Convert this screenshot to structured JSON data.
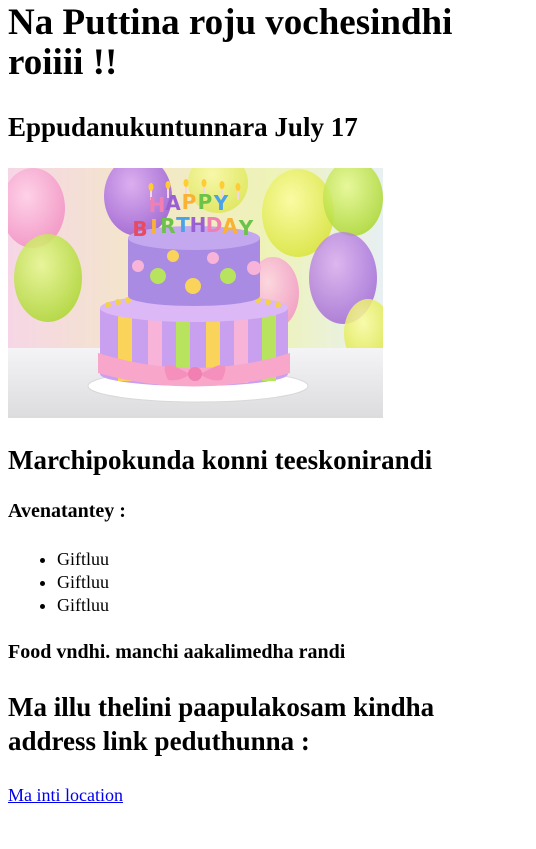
{
  "heading": "Na Puttina roju vochesindhi roiiii !!",
  "subheading": "Eppudanukuntunnara July 17",
  "image": {
    "description_icon": "birthday-cake-image",
    "cake_topper_text": "HAPPY BIRTHDAY"
  },
  "line1": "Marchipokunda konni teeskonirandi",
  "avenatantey": "Avenatantey :",
  "gifts": [
    "Giftluu",
    "Giftluu",
    "Giftluu"
  ],
  "food": "Food vndhi. manchi aakalimedha randi",
  "address_heading": "Ma illu thelini paapulakosam kindha address link peduthunna :",
  "location_link": "Ma inti location",
  "colors": {
    "link": "#0000ee",
    "text": "#000000"
  }
}
